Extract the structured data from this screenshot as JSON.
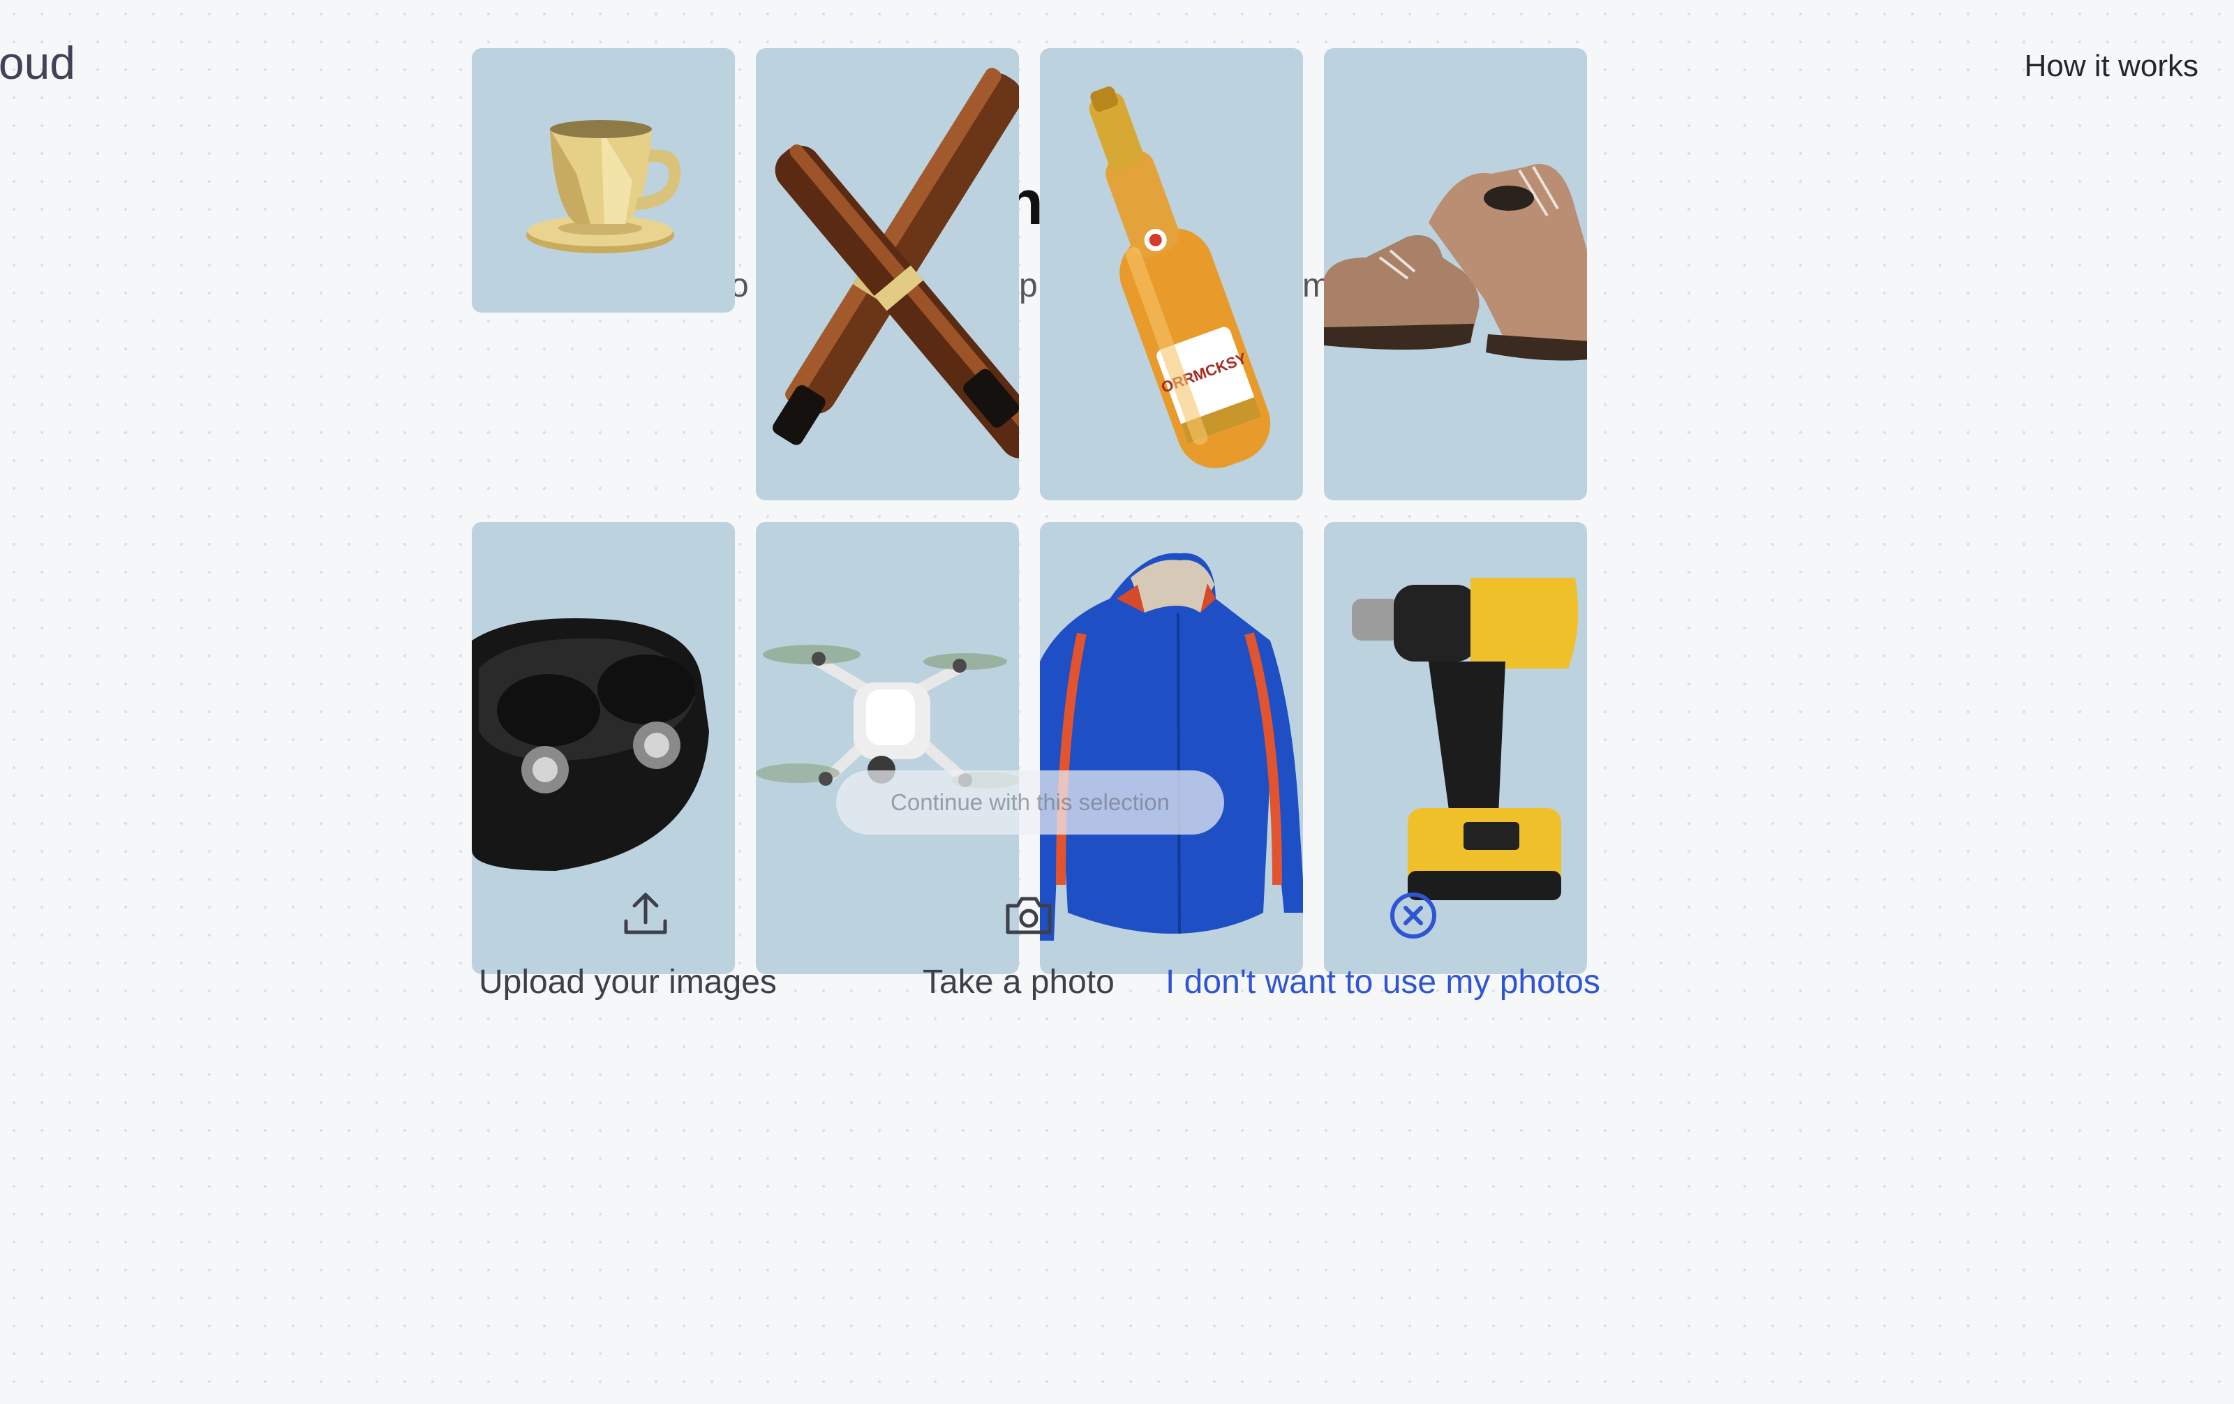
{
  "header": {
    "brand": "oud",
    "how_it_works": "How it works"
  },
  "background": {
    "title_fragment": "n",
    "subtitle_fragments": [
      "o",
      "p",
      "m"
    ]
  },
  "gallery": {
    "tiles": [
      {
        "name": "teacup"
      },
      {
        "name": "fountain-pens"
      },
      {
        "name": "sparkling-wine-bottle",
        "label": "ORRMCKSY"
      },
      {
        "name": "leather-shoes"
      },
      {
        "name": "wireless-earbuds"
      },
      {
        "name": "drone"
      },
      {
        "name": "track-jacket"
      },
      {
        "name": "cordless-drill"
      }
    ]
  },
  "actions": {
    "continue_label": "Continue with this selection",
    "upload_label": "Upload your images",
    "photo_label": "Take a photo",
    "skip_label": "I don't want to use my photos",
    "upload_icon": "upload-icon",
    "camera_icon": "camera-icon",
    "skip_icon": "close-circle-icon"
  },
  "colors": {
    "page_bg": "#f6f7f9",
    "tile_bg": "#bcd2de",
    "accent_blue": "#2f55d4",
    "text_dark": "#3d3f4a"
  }
}
